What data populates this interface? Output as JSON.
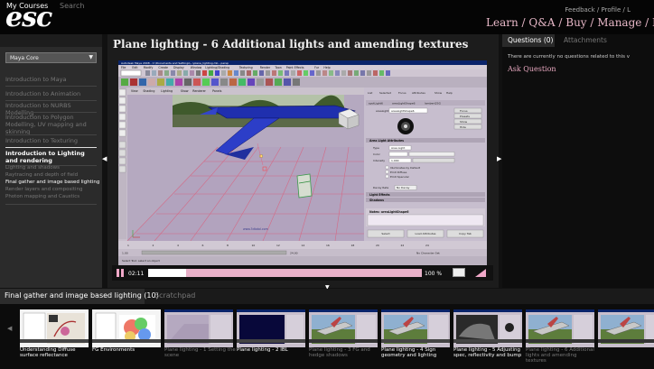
{
  "brand": {
    "logo": "esc"
  },
  "header": {
    "top_links": "Feedback / Profile / L",
    "nav": "Learn / Q&A / Buy / Manage / L"
  },
  "left_panel": {
    "tabs": [
      "My Courses",
      "Search"
    ],
    "course_select": "Maya Core",
    "chapters": [
      {
        "label": "Introduction to Maya"
      },
      {
        "label": "Introduction to Animation"
      },
      {
        "label": "Introduction to NURBS Modelling"
      },
      {
        "label": "Introduction to Polygon Modelling, UV mapping and skinning"
      },
      {
        "label": "Introduction to Texturing"
      },
      {
        "label": "Introduction to Lighting and rendering"
      }
    ],
    "sub_items": [
      {
        "label": "Lighting and shadows",
        "active": false
      },
      {
        "label": "Raytracing and depth of field",
        "active": false
      },
      {
        "label": "Final gather and image based lighting",
        "active": true
      },
      {
        "label": "Render layers and compositing",
        "active": false
      },
      {
        "label": "Photon mapping and Caustics",
        "active": false
      }
    ]
  },
  "video": {
    "title": "Plane lighting - 6 Additional lights and amending textures",
    "time": "02:11",
    "progress": 0.14,
    "zoom": "100 %",
    "maya": {
      "title_bar": "Autodesk Maya 2008 - C:\\Documents and Settings\\...\\plane_lighting.mb - persp",
      "menu": [
        "File",
        "Edit",
        "Modify",
        "Create",
        "Display",
        "Window",
        "Lighting/Shading",
        "Texturing",
        "Render",
        "Toon",
        "Paint Effects",
        "Fur",
        "Help"
      ],
      "channel_tabs": [
        "List",
        "Selected",
        "Focus",
        "Attributes",
        "Show",
        "Help"
      ],
      "node_tabs": [
        "spotLight6",
        "areaLightShape6",
        "lambert2SG"
      ],
      "node_type": "areaLight:",
      "node_name": "areaLightShape6",
      "panel_buttons": [
        "Focus",
        "Presets",
        "Show",
        "Hide"
      ],
      "sample_label": "Area Light Attributes",
      "attr_rows": [
        {
          "label": "Type",
          "value": "Area Light"
        },
        {
          "label": "Color",
          "value": ""
        },
        {
          "label": "Intensity",
          "value": "1.000"
        }
      ],
      "checkboxes": [
        "Illuminates by Default",
        "Emit Diffuse",
        "Emit Specular"
      ],
      "decay": {
        "label": "Decay Rate",
        "value": "No Decay"
      },
      "sections": [
        "Light Effects",
        "Shadows"
      ],
      "notes_label": "Notes: areaLightShape6",
      "bottom_buttons": [
        "Select",
        "Load Attributes",
        "Copy Tab"
      ],
      "viewport_menu": [
        "View",
        "Shading",
        "Lighting",
        "Show",
        "Renderer",
        "Panels"
      ],
      "watermark": "www.3dtotal.com",
      "timeline_ticks": [
        "1",
        "2",
        "4",
        "6",
        "8",
        "10",
        "12",
        "14",
        "16",
        "18",
        "20",
        "22",
        "24"
      ],
      "range_start": "1.00",
      "range_end": "24.00",
      "char_set": "No Character Set",
      "status": "Select Tool: select an object"
    }
  },
  "questions": {
    "tabs": [
      "Questions (0)",
      "Attachments"
    ],
    "empty_text": "There are currently no questions related to this v",
    "ask_label": "Ask Question"
  },
  "playlist": {
    "tabs": [
      "Final gather and image based lighting (10)",
      "Scratchpad"
    ],
    "items": [
      {
        "label": "Understanding Diffuse surface reflectance",
        "watched": true,
        "thumb": "diagram"
      },
      {
        "label": "FG Environments",
        "watched": true,
        "thumb": "flower"
      },
      {
        "label": "Plane lighting - 1 Setting the scene",
        "watched": false,
        "thumb": "maya"
      },
      {
        "label": "Plane lighting - 2 IBL",
        "watched": true,
        "thumb": "maya-blue"
      },
      {
        "label": "Plane lighting - 3 FG and hedge shadows",
        "watched": false,
        "thumb": "plane"
      },
      {
        "label": "Plane lighting - 4 Sign geometry and lighting",
        "watched": true,
        "thumb": "plane"
      },
      {
        "label": "Plane lighting - 5 Adjusting spec, reflectivity and bump",
        "watched": true,
        "thumb": "texture"
      },
      {
        "label": "Plane lighting - 6 Additional lights and amending textures",
        "watched": false,
        "thumb": "plane"
      },
      {
        "label": "",
        "watched": false,
        "thumb": "plane"
      }
    ]
  },
  "colors": {
    "accent": "#e8b0c8",
    "background": "#111111"
  }
}
